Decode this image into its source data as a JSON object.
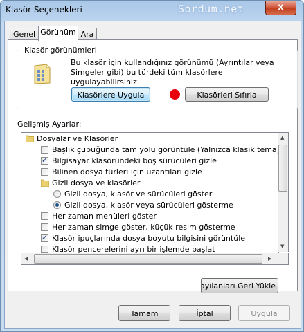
{
  "window": {
    "title": "Klasör Seçenekleri",
    "watermark": "Sordum.net",
    "close_glyph": "x"
  },
  "tabs": [
    {
      "label": "Genel",
      "active": false
    },
    {
      "label": "Görünüm",
      "active": true
    },
    {
      "label": "Ara",
      "active": false
    }
  ],
  "folder_views": {
    "group_title": "Klasör görünümleri",
    "description": "Bu klasör için kullandığınız görünümü (Ayrıntılar veya Simgeler gibi) bu türdeki tüm klasörlere uygulayabilirsiniz.",
    "apply_button": "Klasörlere Uygula",
    "reset_button": "Klasörleri Sıfırla"
  },
  "advanced": {
    "label": "Gelişmiş Ayarlar:",
    "items": [
      {
        "type": "folder",
        "level": 0,
        "text": "Dosyalar ve Klasörler"
      },
      {
        "type": "checkbox",
        "level": 1,
        "checked": false,
        "text": "Başlık çubuğunda tam yolu görüntüle (Yalnızca klasik tema)"
      },
      {
        "type": "checkbox",
        "level": 1,
        "checked": true,
        "text": "Bilgisayar klasöründeki boş sürücüleri gizle"
      },
      {
        "type": "checkbox",
        "level": 1,
        "checked": false,
        "text": "Bilinen dosya türleri için uzantıları gizle"
      },
      {
        "type": "folder",
        "level": 1,
        "text": "Gizli dosya ve klasörler"
      },
      {
        "type": "radio",
        "level": 2,
        "checked": false,
        "text": "Gizli dosya, klasör ve sürücüleri göster"
      },
      {
        "type": "radio",
        "level": 2,
        "checked": true,
        "text": "Gizli dosya, klasör veya sürücüleri gösterme"
      },
      {
        "type": "checkbox",
        "level": 1,
        "checked": false,
        "text": "Her zaman menüleri göster"
      },
      {
        "type": "checkbox",
        "level": 1,
        "checked": false,
        "text": "Her zaman simge göster, küçük resim gösterme"
      },
      {
        "type": "checkbox",
        "level": 1,
        "checked": true,
        "text": "Klasör ipuçlarında dosya boyutu bilgisini görüntüle"
      },
      {
        "type": "checkbox",
        "level": 1,
        "checked": false,
        "text": "Klasör pencerelerini ayrı bir işlemde başlat"
      }
    ],
    "restore_button": "Varsayılanları Geri Yükle"
  },
  "footer": {
    "ok": "Tamam",
    "cancel": "İptal",
    "apply": "Uygula"
  },
  "colors": {
    "title_bar": "#bcd4ee",
    "close_button": "#c94a2e",
    "red_dot": "#e8000b",
    "panel": "#ffffff"
  }
}
